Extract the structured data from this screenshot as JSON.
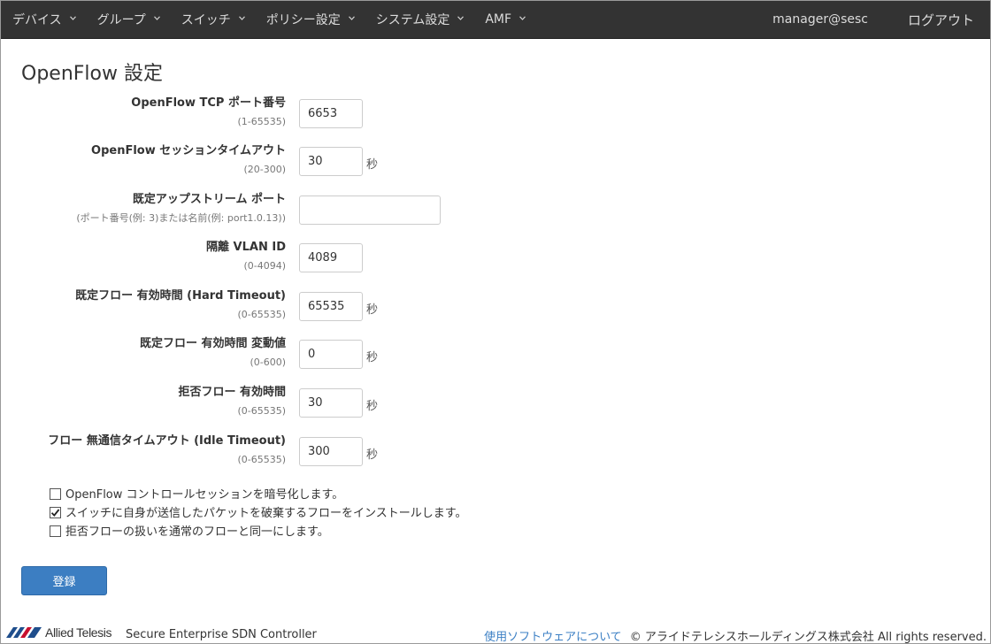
{
  "nav": {
    "items": [
      {
        "label": "デバイス"
      },
      {
        "label": "グループ"
      },
      {
        "label": "スイッチ"
      },
      {
        "label": "ポリシー設定"
      },
      {
        "label": "システム設定"
      },
      {
        "label": "AMF"
      }
    ],
    "user": "manager@sesc",
    "logout": "ログアウト",
    "chevron_icon": "chevron-down-icon"
  },
  "page": {
    "title": "OpenFlow 設定"
  },
  "form": {
    "rows": [
      {
        "label": "OpenFlow TCP ポート番号",
        "hint": "(1-65535)",
        "value": "6653",
        "unit": ""
      },
      {
        "label": "OpenFlow セッションタイムアウト",
        "hint": "(20-300)",
        "value": "30",
        "unit": "秒"
      },
      {
        "label": "既定アップストリーム ポート",
        "hint": "(ポート番号(例: 3)または名前(例: port1.0.13))",
        "value": "",
        "unit": ""
      },
      {
        "label": "隔離 VLAN ID",
        "hint": "(0-4094)",
        "value": "4089",
        "unit": ""
      },
      {
        "label": "既定フロー 有効時間 (Hard Timeout)",
        "hint": "(0-65535)",
        "value": "65535",
        "unit": "秒"
      },
      {
        "label": "既定フロー 有効時間 変動値",
        "hint": "(0-600)",
        "value": "0",
        "unit": "秒"
      },
      {
        "label": "拒否フロー 有効時間",
        "hint": "(0-65535)",
        "value": "30",
        "unit": "秒"
      },
      {
        "label": "フロー 無通信タイムアウト (Idle Timeout)",
        "hint": "(0-65535)",
        "value": "300",
        "unit": "秒"
      }
    ],
    "checkboxes": [
      {
        "label": "OpenFlow コントロールセッションを暗号化します。",
        "checked": false
      },
      {
        "label": "スイッチに自身が送信したパケットを破棄するフローをインストールします。",
        "checked": true
      },
      {
        "label": "拒否フローの扱いを通常のフローと同一にします。",
        "checked": false
      }
    ],
    "submit_label": "登録"
  },
  "footer": {
    "logo_text": "Allied Telesis",
    "product": "Secure Enterprise SDN Controller",
    "link": "使用ソフトウェアについて",
    "copyright": "© アライドテレシスホールディングス株式会社 All rights reserved."
  },
  "colors": {
    "navbar": "#333333",
    "accent": "#3c7ec2",
    "link": "#3b7fc4",
    "logo": "#1f4e8c"
  }
}
